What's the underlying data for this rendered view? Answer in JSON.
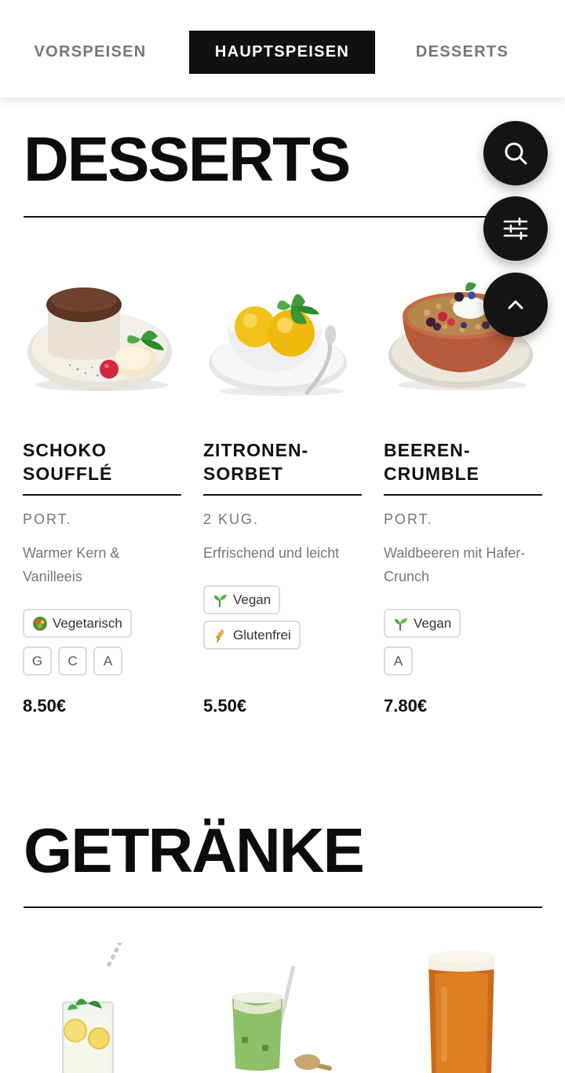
{
  "tabs": [
    {
      "label": "VORSPEISEN",
      "active": false
    },
    {
      "label": "HAUPTSPEISEN",
      "active": true
    },
    {
      "label": "DESSERTS",
      "active": false
    }
  ],
  "desserts": {
    "title": "DESSERTS",
    "items": [
      {
        "name": "SCHOKO\nSOUFFLÉ",
        "portion": "PORT.",
        "description": "Warmer Kern & Vanilleeis",
        "tags": [
          {
            "label": "Vegetarisch",
            "icon": "vegetarian-icon"
          }
        ],
        "allergens": [
          "G",
          "C",
          "A"
        ],
        "price": "8.50€"
      },
      {
        "name": "ZITRONEN-\nSORBET",
        "portion": "2 KUG.",
        "description": "Erfrischend und leicht",
        "tags": [
          {
            "label": "Vegan",
            "icon": "sprout-icon"
          },
          {
            "label": "Glutenfrei",
            "icon": "wheat-icon"
          }
        ],
        "allergens": [],
        "price": "5.50€"
      },
      {
        "name": "BEEREN-\nCRUMBLE",
        "portion": "PORT.",
        "description": "Waldbeeren mit Hafer-Crunch",
        "tags": [
          {
            "label": "Vegan",
            "icon": "sprout-icon"
          }
        ],
        "allergens": [
          "A"
        ],
        "price": "7.80€"
      }
    ]
  },
  "drinks": {
    "title": "GETRÄNKE"
  },
  "fab": [
    {
      "icon": "search-icon"
    },
    {
      "icon": "filter-sliders-icon"
    },
    {
      "icon": "chevron-up-icon"
    }
  ]
}
